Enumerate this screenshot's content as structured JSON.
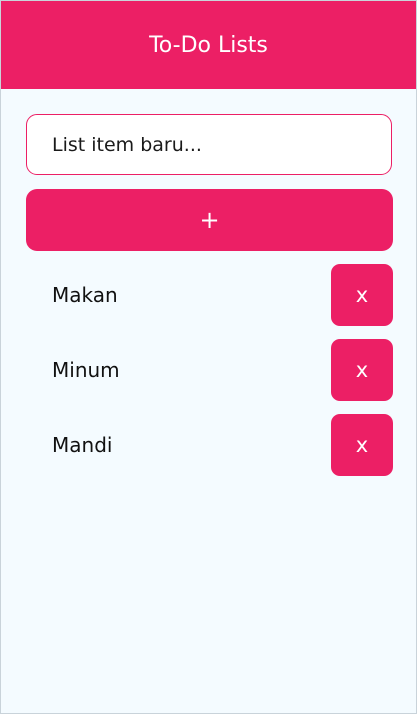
{
  "header": {
    "title": "To-Do Lists"
  },
  "form": {
    "input_placeholder": "List item baru...",
    "input_value": "",
    "add_label": "+"
  },
  "items": [
    {
      "label": "Makan",
      "delete_label": "x"
    },
    {
      "label": "Minum",
      "delete_label": "x"
    },
    {
      "label": "Mandi",
      "delete_label": "x"
    }
  ],
  "colors": {
    "accent": "#ec1f65",
    "background": "#f4fbff",
    "text": "#111111"
  }
}
